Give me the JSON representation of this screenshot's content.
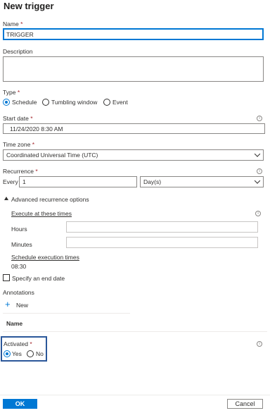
{
  "panel": {
    "title": "New trigger"
  },
  "name": {
    "label": "Name",
    "required": "*",
    "value": "TRIGGER"
  },
  "description": {
    "label": "Description",
    "value": ""
  },
  "type": {
    "label": "Type",
    "required": "*",
    "options": [
      "Schedule",
      "Tumbling window",
      "Event"
    ],
    "selected": "Schedule"
  },
  "start_date": {
    "label": "Start date",
    "required": "*",
    "value": "11/24/2020 8:30 AM",
    "info_icon": "info-icon"
  },
  "time_zone": {
    "label": "Time zone",
    "required": "*",
    "value": "Coordinated Universal Time (UTC)"
  },
  "recurrence": {
    "label": "Recurrence",
    "required": "*",
    "every_label": "Every",
    "interval": "1",
    "unit": "Day(s)"
  },
  "advanced": {
    "toggle_label": "Advanced recurrence options",
    "execute_label": "Execute at these times",
    "hours_label": "Hours",
    "minutes_label": "Minutes",
    "schedule_label": "Schedule execution times",
    "schedule_value": "08:30"
  },
  "end_date": {
    "label": "Specify an end date",
    "checked": false
  },
  "annotations": {
    "label": "Annotations",
    "new_label": "New",
    "column_header": "Name"
  },
  "activated": {
    "label": "Activated",
    "required": "*",
    "options": [
      "Yes",
      "No"
    ],
    "selected": "Yes",
    "highlight_color": "#2b579a"
  },
  "footer": {
    "ok_label": "OK",
    "cancel_label": "Cancel"
  },
  "colors": {
    "accent": "#0078d4",
    "required": "#a4262c"
  }
}
